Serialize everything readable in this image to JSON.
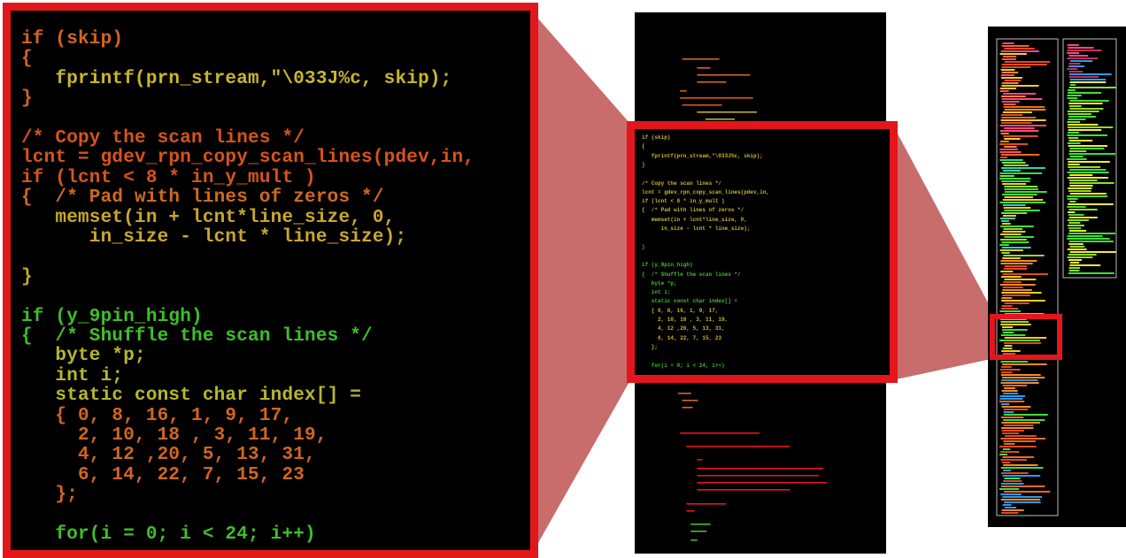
{
  "zoomed_code": {
    "lines": [
      {
        "text": "if (skip)",
        "color": "#d2661f"
      },
      {
        "text": "{",
        "color": "#d2661f"
      },
      {
        "text": "   fprintf(prn_stream,\"\\033J%c, skip);",
        "color": "#c9b72a"
      },
      {
        "text": "}",
        "color": "#d2661f"
      },
      {
        "text": "",
        "color": "#d2661f"
      },
      {
        "text": "/* Copy the scan lines */",
        "color": "#d9531a"
      },
      {
        "text": "lcnt = gdev_rpn_copy_scan_lines(pdev,in,",
        "color": "#d9531a"
      },
      {
        "text": "if (lcnt < 8 * in_y_mult )",
        "color": "#d9531a"
      },
      {
        "text": "{  /* Pad with lines of zeros */",
        "color": "#cf6a1c"
      },
      {
        "text": "   memset(in + lcnt*line_size, 0,",
        "color": "#c9a82a"
      },
      {
        "text": "      in_size - lcnt * line_size);",
        "color": "#c9a82a"
      },
      {
        "text": "",
        "color": "#c9a82a"
      },
      {
        "text": "}",
        "color": "#c9a82a"
      },
      {
        "text": "",
        "color": "#c9a82a"
      },
      {
        "text": "if (y_9pin_high)",
        "color": "#3fbf2a"
      },
      {
        "text": "{  /* Shuffle the scan lines */",
        "color": "#3fbf2a"
      },
      {
        "text": "   byte *p;",
        "color": "#b4b82c"
      },
      {
        "text": "   int i;",
        "color": "#b4b82c"
      },
      {
        "text": "   static const char index[] =",
        "color": "#b4b82c"
      },
      {
        "text": "   { 0, 8, 16, 1, 9, 17,",
        "color": "#d2661f"
      },
      {
        "text": "     2, 10, 18 , 3, 11, 19,",
        "color": "#d2661f"
      },
      {
        "text": "     4, 12 ,20, 5, 13, 31,",
        "color": "#d2661f"
      },
      {
        "text": "     6, 14, 22, 7, 15, 23",
        "color": "#d2661f"
      },
      {
        "text": "   };",
        "color": "#d2661f"
      },
      {
        "text": "",
        "color": "#d2661f"
      },
      {
        "text": "   for(i = 0; i < 24; i++)",
        "color": "#3fbf2a"
      }
    ]
  },
  "mid_code": {
    "lines": [
      {
        "text": "if (skip)",
        "color": "#c9b72a"
      },
      {
        "text": "{",
        "color": "#c9b72a"
      },
      {
        "text": "   fprintf(prn_stream,\"\\033J%c, skip);",
        "color": "#c9b72a"
      },
      {
        "text": "}",
        "color": "#c9b72a"
      },
      {
        "text": "",
        "color": "#c9b72a"
      },
      {
        "text": "/* Copy the scan lines */",
        "color": "#c9b72a"
      },
      {
        "text": "lcnt = gdev_rpn_copy_scan_lines(pdev,in,",
        "color": "#c9b72a"
      },
      {
        "text": "if (lcnt < 8 * in_y_mult )",
        "color": "#c9b72a"
      },
      {
        "text": "{  /* Pad with lines of zeros */",
        "color": "#c9b72a"
      },
      {
        "text": "   memset(in + lcnt*line_size, 0,",
        "color": "#c9b72a"
      },
      {
        "text": "      in_size - lcnt * line_size);",
        "color": "#c9b72a"
      },
      {
        "text": "",
        "color": "#c9b72a"
      },
      {
        "text": "}",
        "color": "#3fbf2a"
      },
      {
        "text": "",
        "color": "#3fbf2a"
      },
      {
        "text": "if (y_9pin_high)",
        "color": "#3fbf2a"
      },
      {
        "text": "{  /* Shuffle the scan lines */",
        "color": "#3fbf2a"
      },
      {
        "text": "   byte *p;",
        "color": "#3fbf2a"
      },
      {
        "text": "   int i;",
        "color": "#3fbf2a"
      },
      {
        "text": "   static const char index[] =",
        "color": "#3fbf2a"
      },
      {
        "text": "   { 0, 8, 16, 1, 9, 17,",
        "color": "#c9b72a"
      },
      {
        "text": "     2, 10, 18 , 3, 11, 19,",
        "color": "#c9b72a"
      },
      {
        "text": "     4, 12 ,20, 5, 13, 31,",
        "color": "#c9b72a"
      },
      {
        "text": "     6, 14, 22, 7, 15, 23",
        "color": "#c9b72a"
      },
      {
        "text": "   };",
        "color": "#c9b72a"
      },
      {
        "text": "",
        "color": "#c9b72a"
      },
      {
        "text": "   for(i = 0; i < 24; i++)",
        "color": "#3fbf2a"
      }
    ]
  },
  "colors": {
    "frame_red": "#e3161b",
    "connector": "#c86d6b",
    "panel_bg": "#000000"
  }
}
